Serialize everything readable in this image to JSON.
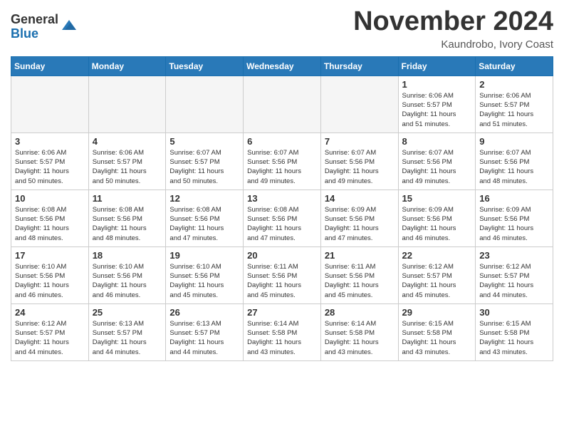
{
  "header": {
    "logo_general": "General",
    "logo_blue": "Blue",
    "month_title": "November 2024",
    "location": "Kaundrobo, Ivory Coast"
  },
  "weekdays": [
    "Sunday",
    "Monday",
    "Tuesday",
    "Wednesday",
    "Thursday",
    "Friday",
    "Saturday"
  ],
  "weeks": [
    [
      {
        "day": "",
        "info": ""
      },
      {
        "day": "",
        "info": ""
      },
      {
        "day": "",
        "info": ""
      },
      {
        "day": "",
        "info": ""
      },
      {
        "day": "",
        "info": ""
      },
      {
        "day": "1",
        "info": "Sunrise: 6:06 AM\nSunset: 5:57 PM\nDaylight: 11 hours\nand 51 minutes."
      },
      {
        "day": "2",
        "info": "Sunrise: 6:06 AM\nSunset: 5:57 PM\nDaylight: 11 hours\nand 51 minutes."
      }
    ],
    [
      {
        "day": "3",
        "info": "Sunrise: 6:06 AM\nSunset: 5:57 PM\nDaylight: 11 hours\nand 50 minutes."
      },
      {
        "day": "4",
        "info": "Sunrise: 6:06 AM\nSunset: 5:57 PM\nDaylight: 11 hours\nand 50 minutes."
      },
      {
        "day": "5",
        "info": "Sunrise: 6:07 AM\nSunset: 5:57 PM\nDaylight: 11 hours\nand 50 minutes."
      },
      {
        "day": "6",
        "info": "Sunrise: 6:07 AM\nSunset: 5:56 PM\nDaylight: 11 hours\nand 49 minutes."
      },
      {
        "day": "7",
        "info": "Sunrise: 6:07 AM\nSunset: 5:56 PM\nDaylight: 11 hours\nand 49 minutes."
      },
      {
        "day": "8",
        "info": "Sunrise: 6:07 AM\nSunset: 5:56 PM\nDaylight: 11 hours\nand 49 minutes."
      },
      {
        "day": "9",
        "info": "Sunrise: 6:07 AM\nSunset: 5:56 PM\nDaylight: 11 hours\nand 48 minutes."
      }
    ],
    [
      {
        "day": "10",
        "info": "Sunrise: 6:08 AM\nSunset: 5:56 PM\nDaylight: 11 hours\nand 48 minutes."
      },
      {
        "day": "11",
        "info": "Sunrise: 6:08 AM\nSunset: 5:56 PM\nDaylight: 11 hours\nand 48 minutes."
      },
      {
        "day": "12",
        "info": "Sunrise: 6:08 AM\nSunset: 5:56 PM\nDaylight: 11 hours\nand 47 minutes."
      },
      {
        "day": "13",
        "info": "Sunrise: 6:08 AM\nSunset: 5:56 PM\nDaylight: 11 hours\nand 47 minutes."
      },
      {
        "day": "14",
        "info": "Sunrise: 6:09 AM\nSunset: 5:56 PM\nDaylight: 11 hours\nand 47 minutes."
      },
      {
        "day": "15",
        "info": "Sunrise: 6:09 AM\nSunset: 5:56 PM\nDaylight: 11 hours\nand 46 minutes."
      },
      {
        "day": "16",
        "info": "Sunrise: 6:09 AM\nSunset: 5:56 PM\nDaylight: 11 hours\nand 46 minutes."
      }
    ],
    [
      {
        "day": "17",
        "info": "Sunrise: 6:10 AM\nSunset: 5:56 PM\nDaylight: 11 hours\nand 46 minutes."
      },
      {
        "day": "18",
        "info": "Sunrise: 6:10 AM\nSunset: 5:56 PM\nDaylight: 11 hours\nand 46 minutes."
      },
      {
        "day": "19",
        "info": "Sunrise: 6:10 AM\nSunset: 5:56 PM\nDaylight: 11 hours\nand 45 minutes."
      },
      {
        "day": "20",
        "info": "Sunrise: 6:11 AM\nSunset: 5:56 PM\nDaylight: 11 hours\nand 45 minutes."
      },
      {
        "day": "21",
        "info": "Sunrise: 6:11 AM\nSunset: 5:56 PM\nDaylight: 11 hours\nand 45 minutes."
      },
      {
        "day": "22",
        "info": "Sunrise: 6:12 AM\nSunset: 5:57 PM\nDaylight: 11 hours\nand 45 minutes."
      },
      {
        "day": "23",
        "info": "Sunrise: 6:12 AM\nSunset: 5:57 PM\nDaylight: 11 hours\nand 44 minutes."
      }
    ],
    [
      {
        "day": "24",
        "info": "Sunrise: 6:12 AM\nSunset: 5:57 PM\nDaylight: 11 hours\nand 44 minutes."
      },
      {
        "day": "25",
        "info": "Sunrise: 6:13 AM\nSunset: 5:57 PM\nDaylight: 11 hours\nand 44 minutes."
      },
      {
        "day": "26",
        "info": "Sunrise: 6:13 AM\nSunset: 5:57 PM\nDaylight: 11 hours\nand 44 minutes."
      },
      {
        "day": "27",
        "info": "Sunrise: 6:14 AM\nSunset: 5:58 PM\nDaylight: 11 hours\nand 43 minutes."
      },
      {
        "day": "28",
        "info": "Sunrise: 6:14 AM\nSunset: 5:58 PM\nDaylight: 11 hours\nand 43 minutes."
      },
      {
        "day": "29",
        "info": "Sunrise: 6:15 AM\nSunset: 5:58 PM\nDaylight: 11 hours\nand 43 minutes."
      },
      {
        "day": "30",
        "info": "Sunrise: 6:15 AM\nSunset: 5:58 PM\nDaylight: 11 hours\nand 43 minutes."
      }
    ]
  ]
}
